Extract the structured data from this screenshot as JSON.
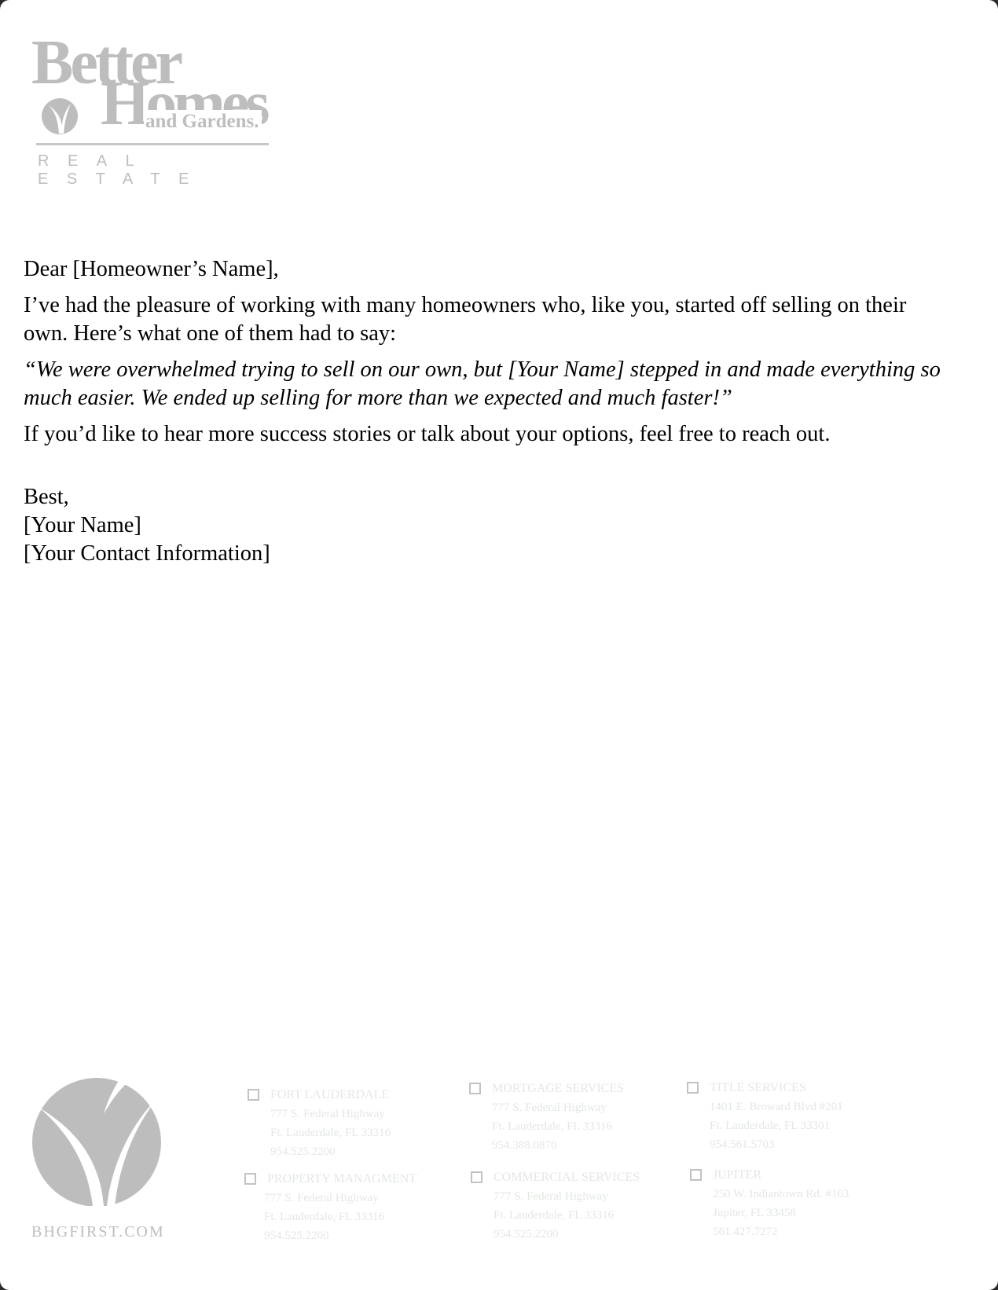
{
  "logo": {
    "line1": "Better",
    "line2": "Homes",
    "line3": "and Gardens.",
    "line4": "REAL ESTATE"
  },
  "letter": {
    "greeting": "Dear [Homeowner’s Name],",
    "paragraph1": "I’ve had the pleasure of working with many homeowners who, like you, started off selling on their own. Here’s what one of them had to say:",
    "quote": "“We were overwhelmed trying to sell on our own, but [Your Name] stepped in and made everything so much easier. We ended up selling for more than we expected and much faster!”",
    "paragraph2": "If you’d like to hear more success stories or talk about your options, feel free to reach out.",
    "closing": "Best,",
    "signature_name": "[Your Name]",
    "signature_contact": "[Your Contact Information]"
  },
  "footer": {
    "url": "BHGFIRST.COM",
    "offices": [
      {
        "name": "FORT LAUDERDALE",
        "address": "777 S. Federal Highway",
        "city": "Ft. Lauderdale, FL 33316",
        "phone": "954.525.2200"
      },
      {
        "name": "MORTGAGE SERVICES",
        "address": "777 S. Federal Highway",
        "city": "Ft. Lauderdale, FL 33316",
        "phone": "954.388.0870"
      },
      {
        "name": "TITLE SERVICES",
        "address": "1401 E. Broward Blvd #201",
        "city": "Ft. Lauderdale, FL 33301",
        "phone": "954.561.5703"
      },
      {
        "name": "PROPERTY MANAGMENT",
        "address": "777 S. Federal Highway",
        "city": "Ft. Lauderdale, FL 33316",
        "phone": "954.525.2200"
      },
      {
        "name": "COMMERCIAL SERVICES",
        "address": "777 S. Federal Highway",
        "city": "Ft. Lauderdale, FL 33316",
        "phone": "954.525.2200"
      },
      {
        "name": "JUPITER",
        "address": "250 W. Indiantown Rd. #103",
        "city": "Jupiter, FL 33458",
        "phone": "561.427.7272"
      }
    ]
  }
}
